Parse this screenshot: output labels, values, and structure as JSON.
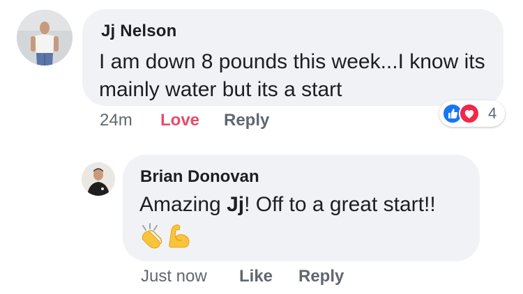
{
  "comments": [
    {
      "author": "Jj Nelson",
      "text": "I am down 8 pounds this week...I know its mainly water but its a start",
      "time": "24m",
      "reaction_action": "Love",
      "reply_action": "Reply",
      "reaction_count": "4",
      "reaction_types": [
        "like-icon",
        "love-icon"
      ],
      "colors": {
        "love": "#e94b66",
        "like": "#1877f2"
      }
    },
    {
      "author": "Brian Donovan",
      "text_before": "Amazing ",
      "text_bold": "Jj",
      "text_after": "! Off to a great start!!",
      "emojis": [
        "clapping-hands-emoji",
        "flexed-biceps-emoji"
      ],
      "time": "Just now",
      "like_action": "Like",
      "reply_action": "Reply"
    }
  ]
}
